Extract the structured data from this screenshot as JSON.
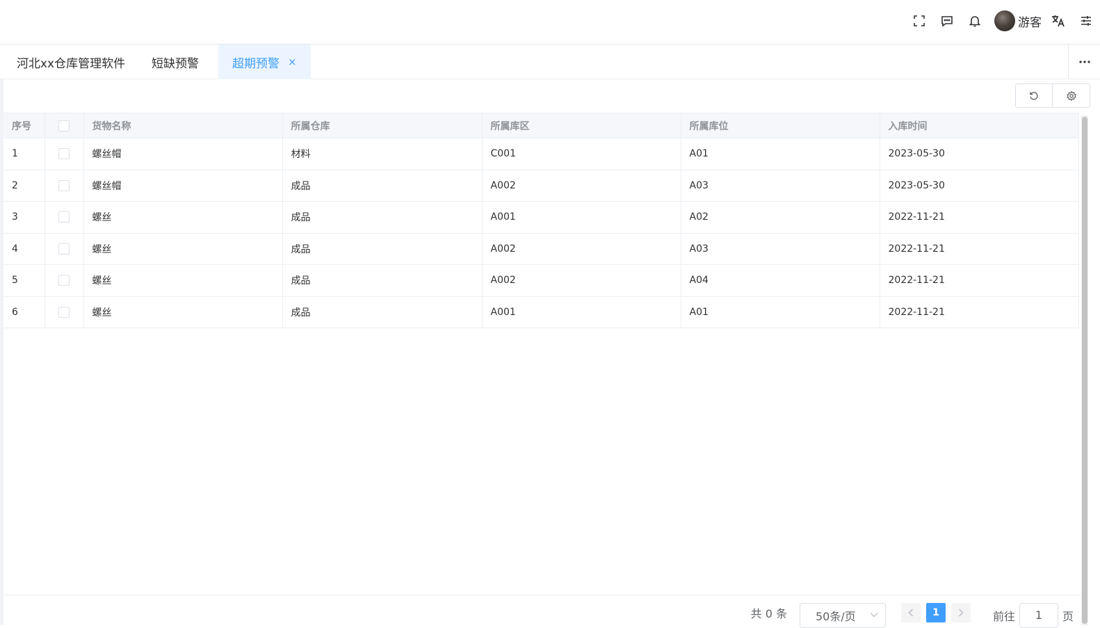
{
  "header": {
    "user_name": "游客",
    "icons": [
      "fullscreen-icon",
      "message-icon",
      "bell-icon",
      "translate-icon",
      "settings-sliders-icon"
    ]
  },
  "tabs": [
    {
      "label": "河北xx仓库管理软件"
    },
    {
      "label": "短缺预警"
    },
    {
      "label": "超期预警",
      "active": true,
      "close": "×"
    }
  ],
  "toolbar": {
    "icons": [
      "refresh-icon",
      "settings-icon"
    ]
  },
  "table": {
    "columns": [
      "序号",
      "",
      "货物名称",
      "所属仓库",
      "所属库区",
      "所属库位",
      "入库时间"
    ],
    "rows": [
      {
        "no": "1",
        "name": "螺丝帽",
        "warehouse": "材料",
        "area": "C001",
        "location": "A01",
        "date": "2023-05-30"
      },
      {
        "no": "2",
        "name": "螺丝帽",
        "warehouse": "成品",
        "area": "A002",
        "location": "A03",
        "date": "2023-05-30"
      },
      {
        "no": "3",
        "name": "螺丝",
        "warehouse": "成品",
        "area": "A001",
        "location": "A02",
        "date": "2022-11-21"
      },
      {
        "no": "4",
        "name": "螺丝",
        "warehouse": "成品",
        "area": "A002",
        "location": "A03",
        "date": "2022-11-21"
      },
      {
        "no": "5",
        "name": "螺丝",
        "warehouse": "成品",
        "area": "A002",
        "location": "A04",
        "date": "2022-11-21"
      },
      {
        "no": "6",
        "name": "螺丝",
        "warehouse": "成品",
        "area": "A001",
        "location": "A01",
        "date": "2022-11-21"
      }
    ]
  },
  "pagination": {
    "total_text": "共 0 条",
    "page_size": "50条/页",
    "current_page": "1",
    "goto_label": "前往",
    "goto_value": "1",
    "page_suffix": "页"
  },
  "colors": {
    "accent": "#409eff",
    "active_tab_bg": "#ecf5ff"
  }
}
